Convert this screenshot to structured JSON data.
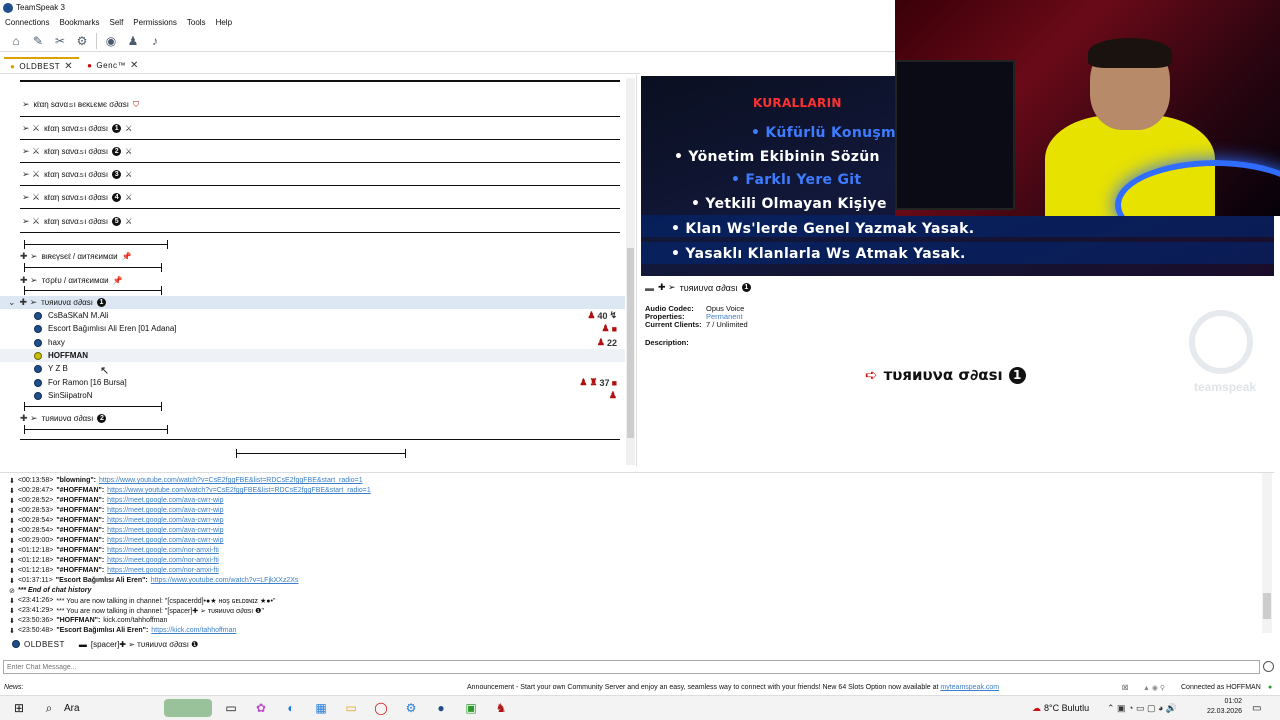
{
  "window": {
    "title": "TeamSpeak 3"
  },
  "menu": [
    "Connections",
    "Bookmarks",
    "Self",
    "Permissions",
    "Tools",
    "Help"
  ],
  "tabs": [
    {
      "label": "OLDBEST"
    },
    {
      "label": "Genc™"
    }
  ],
  "tree": {
    "clan_lobby": "кℓαη ѕανα𝚜ι ʙєκʟємє σ∂αѕı",
    "clan_rooms": [
      {
        "label": "кℓαη ѕανα𝚜ι σ∂αѕı",
        "num": "1"
      },
      {
        "label": "кℓαη ѕανα𝚜ι σ∂αѕı",
        "num": "2"
      },
      {
        "label": "кℓαη ѕανα𝚜ι σ∂αѕı",
        "num": "3"
      },
      {
        "label": "кℓαη ѕανα𝚜ι σ∂αѕı",
        "num": "4"
      },
      {
        "label": "кℓαη ѕανα𝚜ι σ∂αѕı",
        "num": "5"
      }
    ],
    "bireysel": "вιʀєүѕєℓ / αитяєимαи",
    "toplu": "тσρℓυ / αитяєимαи",
    "turnuva1": "тυяиυνα σ∂αѕı",
    "turnuva1_num": "1",
    "users": [
      {
        "name": "CsBaSKaN M.Ali",
        "badge": "40",
        "talking": false,
        "bold": false
      },
      {
        "name": "Escort Bağımlısı Ali Eren [01 Adana]",
        "badge": "",
        "talking": false,
        "bold": false
      },
      {
        "name": "haxy",
        "badge": "22",
        "talking": false,
        "bold": false
      },
      {
        "name": "HOFFMAN",
        "badge": "",
        "talking": true,
        "bold": true
      },
      {
        "name": "Y Z B",
        "badge": "",
        "talking": false,
        "bold": false
      },
      {
        "name": "For Ramon [16 Bursa]",
        "badge": "37",
        "talking": false,
        "bold": false
      },
      {
        "name": "SinSiipatroN",
        "badge": "",
        "talking": false,
        "bold": false
      }
    ],
    "turnuva2": "тυяиυνα σ∂αѕı",
    "turnuva2_num": "2"
  },
  "banner": {
    "heading": "KURALLARIN",
    "lines": [
      "• Küfürlü Konuşm",
      "• Yönetim Ekibinin Sözün",
      "• Farklı Yere Git",
      "• Yetkili Olmayan Kişiye",
      "• Klan Ws'lerde Genel Yazmak Yasak.",
      "• Yasaklı Klanlarla Ws Atmak Yasak."
    ]
  },
  "info": {
    "channel": "тυяиυνα σ∂αѕı",
    "num": "1",
    "codec_label": "Audio Codec:",
    "codec": "Opus Voice",
    "props_label": "Properties:",
    "props": "Permanent",
    "clients_label": "Current Clients:",
    "clients": "7 / Unlimited",
    "desc_label": "Description:",
    "big_title": "тυяиυνα σ∂αѕı",
    "watermark": "teamspeak"
  },
  "chat": [
    {
      "ts": "<00:13:58>",
      "who": "\"blowning\":",
      "msg": "https://www.youtube.com/watch?v=CsE2fggFBE&list=RDCsE2fggFBE&start_radio=1",
      "link": true
    },
    {
      "ts": "<00:28:47>",
      "who": "\"#HOFFMAN\":",
      "msg": "https://www.youtube.com/watch?v=CsE2fggFBE&list=RDCsE2fggFBE&start_radio=1",
      "link": true
    },
    {
      "ts": "<00:28:52>",
      "who": "\"#HOFFMAN\":",
      "msg": "https://meet.google.com/ava-cwrr-wip",
      "link": true
    },
    {
      "ts": "<00:28:53>",
      "who": "\"#HOFFMAN\":",
      "msg": "https://meet.google.com/ava-cwrr-wip",
      "link": true
    },
    {
      "ts": "<00:28:54>",
      "who": "\"#HOFFMAN\":",
      "msg": "https://meet.google.com/ava-cwrr-wip",
      "link": true
    },
    {
      "ts": "<00:28:54>",
      "who": "\"#HOFFMAN\":",
      "msg": "https://meet.google.com/ava-cwrr-wip",
      "link": true
    },
    {
      "ts": "<00:29:00>",
      "who": "\"#HOFFMAN\":",
      "msg": "https://meet.google.com/ava-cwrr-wip",
      "link": true
    },
    {
      "ts": "<01:12:18>",
      "who": "\"#HOFFMAN\":",
      "msg": "https://meet.google.com/nor-amxi-fti",
      "link": true
    },
    {
      "ts": "<01:12:18>",
      "who": "\"#HOFFMAN\":",
      "msg": "https://meet.google.com/nor-amxi-fti",
      "link": true
    },
    {
      "ts": "<01:12:18>",
      "who": "\"#HOFFMAN\":",
      "msg": "https://meet.google.com/nor-amxi-fti",
      "link": true
    },
    {
      "ts": "<01:37:11>",
      "who": "\"Escort Bağımlısı Ali Eren\":",
      "msg": "https://www.youtube.com/watch?v=LFjkXXz2Xs",
      "link": true
    },
    {
      "ts": "",
      "who": "",
      "msg": "*** End of chat history",
      "link": false,
      "italic": true
    },
    {
      "ts": "<23:41:26>",
      "who": "",
      "msg": "*** You are now talking in channel: \"[cspacerdd]•●★ ʜᴏş ɢᴇʟᴅɪɴɪᴢ ★●•\"",
      "link": false
    },
    {
      "ts": "<23:41:29>",
      "who": "",
      "msg": "*** You are now talking in channel: \"[spacer]✚ ➢ тυяиυνα σ∂αѕı ❶\"",
      "link": false
    },
    {
      "ts": "<23:50:36>",
      "who": "\"HOFFMAN\":",
      "msg": "kick.com/tahhoffman",
      "link": false
    },
    {
      "ts": "<23:50:48>",
      "who": "\"Escort Bağımlısı Ali Eren\":",
      "msg": "https://kick.com/tahhoffman",
      "link": true
    }
  ],
  "chat_tabs": [
    {
      "label": "OLDBEST"
    },
    {
      "label": "[spacer]✚ ➢ тυяиυνα σ∂αѕı ❶"
    }
  ],
  "chat_input": {
    "placeholder": "Enter Chat Message..."
  },
  "status": {
    "left": "News:",
    "announcement": "Announcement - Start your own Community Server and enjoy an easy, seamless way to connect with your friends! New 64 Slots Option now available at",
    "link": "myteamspeak.com",
    "connected": "Connected as HOFFMAN"
  },
  "taskbar": {
    "search": "Ara",
    "weather": "8°C  Bulutlu",
    "time": "01:02",
    "date": "22.03.2026"
  }
}
